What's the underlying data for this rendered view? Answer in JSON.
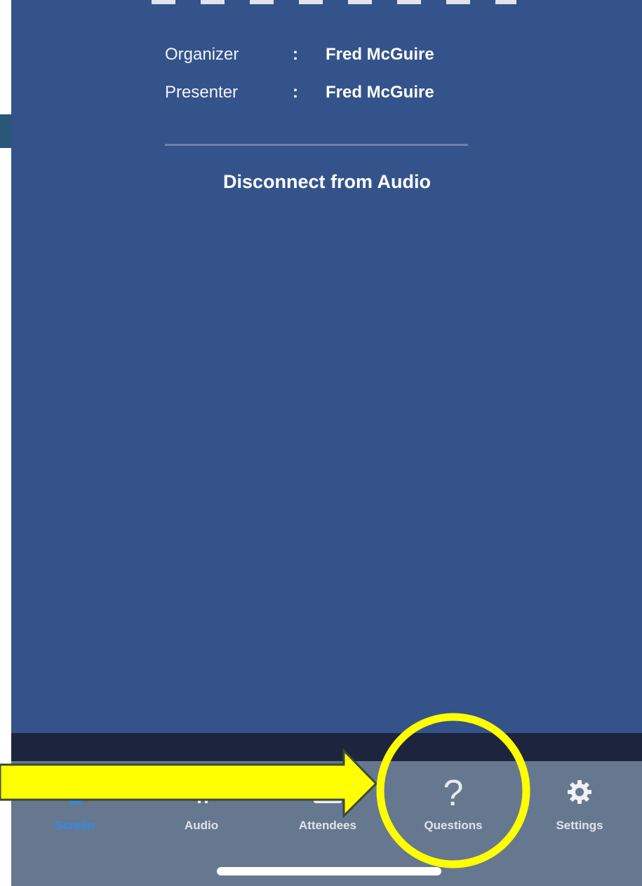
{
  "header": {
    "organizer_label": "Organizer",
    "organizer_sep": ":",
    "organizer_name": "Fred McGuire",
    "presenter_label": "Presenter",
    "presenter_sep": ":",
    "presenter_name": "Fred McGuire"
  },
  "actions": {
    "disconnect_label": "Disconnect from Audio"
  },
  "tabbar": {
    "items": [
      {
        "label": "Screen",
        "icon": "screen-icon",
        "active": true
      },
      {
        "label": "Audio",
        "icon": "audio-icon",
        "active": false
      },
      {
        "label": "Attendees",
        "icon": "attendees-icon",
        "active": false
      },
      {
        "label": "Questions",
        "icon": "question-icon",
        "active": false,
        "glyph": "?"
      },
      {
        "label": "Settings",
        "icon": "gear-icon",
        "active": false
      }
    ]
  },
  "colors": {
    "panel": "#34538a",
    "tabbar": "#66788f",
    "active_tab": "#2d8bf0",
    "highlight": "#ffff00"
  }
}
